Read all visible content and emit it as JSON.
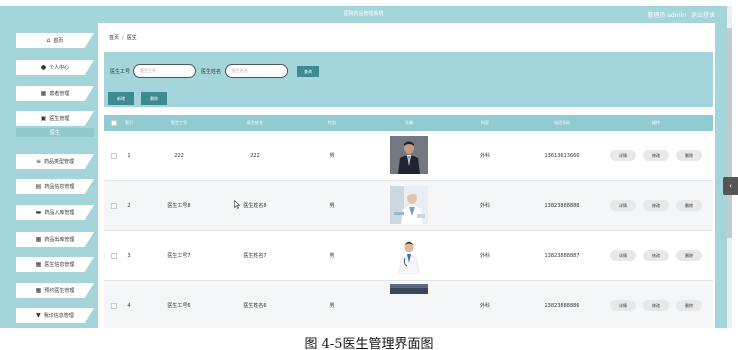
{
  "topbar": {
    "title": "医院药品管理系统",
    "user_label": "管理员 admin",
    "logout": "退出登录"
  },
  "sidebar": {
    "items": [
      {
        "icon": "home-icon",
        "glyph": "⌂",
        "label": "首页"
      },
      {
        "icon": "user-icon",
        "glyph": "●",
        "label": "个人中心"
      },
      {
        "icon": "grid-icon",
        "glyph": "▦",
        "label": "患者管理"
      },
      {
        "icon": "doctor-icon",
        "glyph": "▣",
        "label": "医生管理"
      },
      {
        "label": "医生",
        "active": true
      },
      {
        "icon": "list-icon",
        "glyph": "≡",
        "label": "药品类型管理"
      },
      {
        "icon": "bag-icon",
        "glyph": "▤",
        "label": "药品信息管理"
      },
      {
        "icon": "inbox-icon",
        "glyph": "▬",
        "label": "药品入库管理"
      },
      {
        "icon": "grid-icon",
        "glyph": "▦",
        "label": "药品出库管理"
      },
      {
        "icon": "grid-icon",
        "glyph": "▦",
        "label": "医生信息管理"
      },
      {
        "icon": "grid-icon",
        "glyph": "▦",
        "label": "预约医生管理"
      },
      {
        "icon": "shield-icon",
        "glyph": "▼",
        "label": "我诊信息管理"
      }
    ]
  },
  "breadcrumb": {
    "home": "首页",
    "sep": "/",
    "current": "医生"
  },
  "search": {
    "doctor_no_label": "医生工号",
    "doctor_no_placeholder": "医生工号",
    "doctor_name_label": "医生姓名",
    "doctor_name_placeholder": "医生姓名",
    "search_button": "查询"
  },
  "toolbar": {
    "add_button": "新增",
    "delete_button": "删除"
  },
  "table": {
    "headers": [
      "索引",
      "医生工号",
      "医生姓名",
      "性别",
      "头像",
      "科室",
      "电话号码",
      "操作"
    ],
    "rows": [
      {
        "index": "1",
        "doctor_no": "222",
        "doctor_name": "222",
        "gender": "男",
        "department": "外科",
        "phone": "13613613666"
      },
      {
        "index": "2",
        "doctor_no": "医生工号8",
        "doctor_name": "医生姓名8",
        "gender": "男",
        "department": "外科",
        "phone": "13823888888"
      },
      {
        "index": "3",
        "doctor_no": "医生工号7",
        "doctor_name": "医生姓名7",
        "gender": "男",
        "department": "外科",
        "phone": "13823888887"
      },
      {
        "index": "4",
        "doctor_no": "医生工号6",
        "doctor_name": "医生姓名6",
        "gender": "男",
        "department": "外科",
        "phone": "13823888886"
      }
    ],
    "actions": {
      "detail": "详情",
      "edit": "修改",
      "delete": "删除"
    }
  },
  "side_tab": "‹",
  "caption": "图 4-5医生管理界面图"
}
